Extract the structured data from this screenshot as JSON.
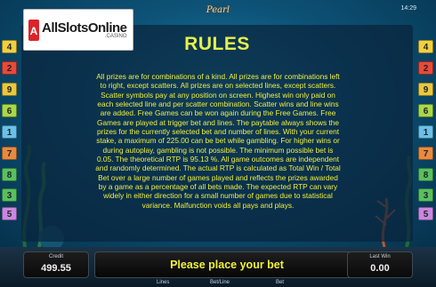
{
  "clock": "14:29",
  "game_logo": "Pearl",
  "brand": {
    "name": "AllSlotsOnline",
    "sub": ".CASINO"
  },
  "rules": {
    "title": "RULES",
    "lines": [
      "All prizes are for combinations of a kind. All prizes are for combinations left",
      "to right, except scatters. All prizes are on selected lines, except scatters.",
      "Scatter symbols pay at any position on screen. Highest win only paid on",
      "each selected line and per scatter combination. Scatter wins and line wins",
      "are added. Free Games can be won again during the Free Games. Free",
      "Games are played at trigger bet and lines. The paytable always shows the",
      "prizes for the currently selected bet and number of lines. With your current",
      "stake, a maximum of 225.00 can be bet while gambling. For higher wins or",
      "during autoplay, gambling is not possible. The minimum possible bet is",
      "0.05. The theoretical RTP is 95.13 %. All game outcomes are independent",
      "and randomly determined. The actual RTP is calculated as Total Win / Total",
      "Bet over a large number of games played and reflects the prizes awarded",
      "by a game as a percentage of all bets made. The expected RTP can vary",
      "widely in either direction for a small number of games due to statistical",
      "variance. Malfunction voids all pays and plays."
    ]
  },
  "line_badges": {
    "left": [
      "4",
      "2",
      "9",
      "6",
      "1",
      "7",
      "8",
      "3",
      "5"
    ],
    "right": [
      "4",
      "2",
      "9",
      "6",
      "1",
      "7",
      "8",
      "3",
      "5"
    ],
    "colors": {
      "4": "#f0d040",
      "2": "#e84a3a",
      "9": "#e8c840",
      "6": "#a8d84a",
      "1": "#6ac0e8",
      "7": "#e88a40",
      "8": "#58c060",
      "3": "#58c060",
      "5": "#c888e0"
    }
  },
  "bottom": {
    "credit_label": "Credit",
    "credit_value": "499.55",
    "message": "Please place your bet",
    "last_win_label": "Last Win",
    "last_win_value": "0.00",
    "lines_label": "Lines",
    "bet_line_label": "Bet/Line",
    "bet_label": "Bet"
  }
}
